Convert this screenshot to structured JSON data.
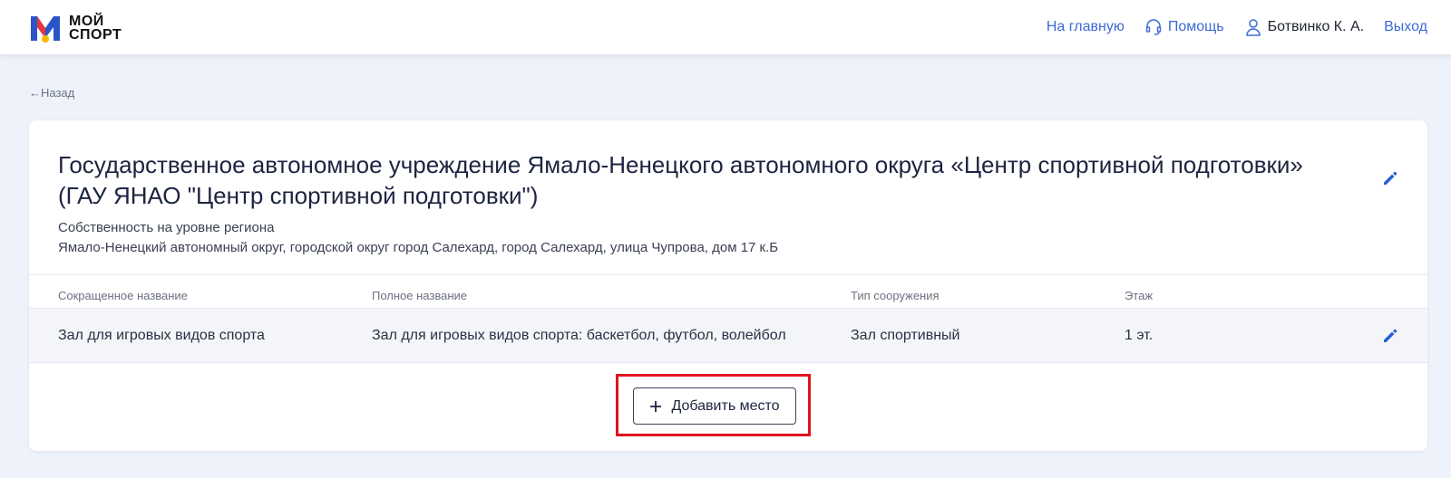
{
  "header": {
    "logo_line1": "МОЙ",
    "logo_line2": "СПОРТ",
    "nav_home": "На главную",
    "nav_help": "Помощь",
    "user_name": "Ботвинко К. А.",
    "nav_logout": "Выход"
  },
  "back_label": "←Назад",
  "organization": {
    "title": "Государственное автономное учреждение Ямало-Ненецкого автономного округа «Центр спортивной подготовки» (ГАУ ЯНАО \"Центр спортивной подготовки\")",
    "ownership": "Собственность на уровне региона",
    "address": "Ямало-Ненецкий автономный округ, городской округ город Салехард, город Салехард, улица Чупрова, дом 17 к.Б"
  },
  "table": {
    "headers": [
      "Сокращенное название",
      "Полное название",
      "Тип сооружения",
      "Этаж"
    ],
    "rows": [
      [
        "Зал для игровых видов спорта",
        "Зал для игровых видов спорта: баскетбол, футбол, волейбол",
        "Зал спортивный",
        "1 эт."
      ]
    ]
  },
  "add_button_label": "Добавить место",
  "colors": {
    "accent": "#3d6ad6",
    "highlight": "#e0141e",
    "background": "#eef2fa"
  },
  "icons": {
    "help": "headset-icon",
    "user": "user-icon",
    "edit": "pencil-icon",
    "add": "plus-icon"
  }
}
